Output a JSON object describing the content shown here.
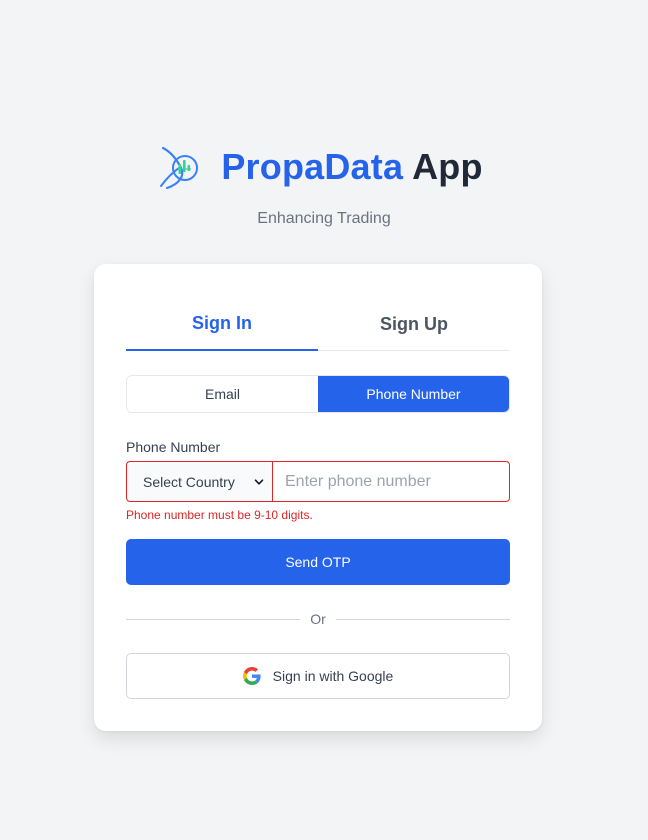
{
  "header": {
    "brand": "PropaData",
    "app": "App",
    "tagline": "Enhancing Trading",
    "logo_icon": "propadata-logo-icon"
  },
  "tabs": [
    {
      "label": "Sign In",
      "active": true
    },
    {
      "label": "Sign Up",
      "active": false
    }
  ],
  "method_toggle": {
    "email_label": "Email",
    "phone_label": "Phone Number",
    "selected": "Phone Number"
  },
  "phone_form": {
    "label": "Phone Number",
    "country_select_value": "Select Country",
    "phone_placeholder": "Enter phone number",
    "phone_value": "",
    "error_message": "Phone number must be 9-10 digits.",
    "submit_label": "Send OTP"
  },
  "divider_label": "Or",
  "google_button": {
    "label": "Sign in with Google",
    "icon": "google-icon"
  },
  "colors": {
    "primary": "#2563eb",
    "error": "#dc2626",
    "background": "#f3f4f6",
    "logo_green": "#34d399"
  }
}
